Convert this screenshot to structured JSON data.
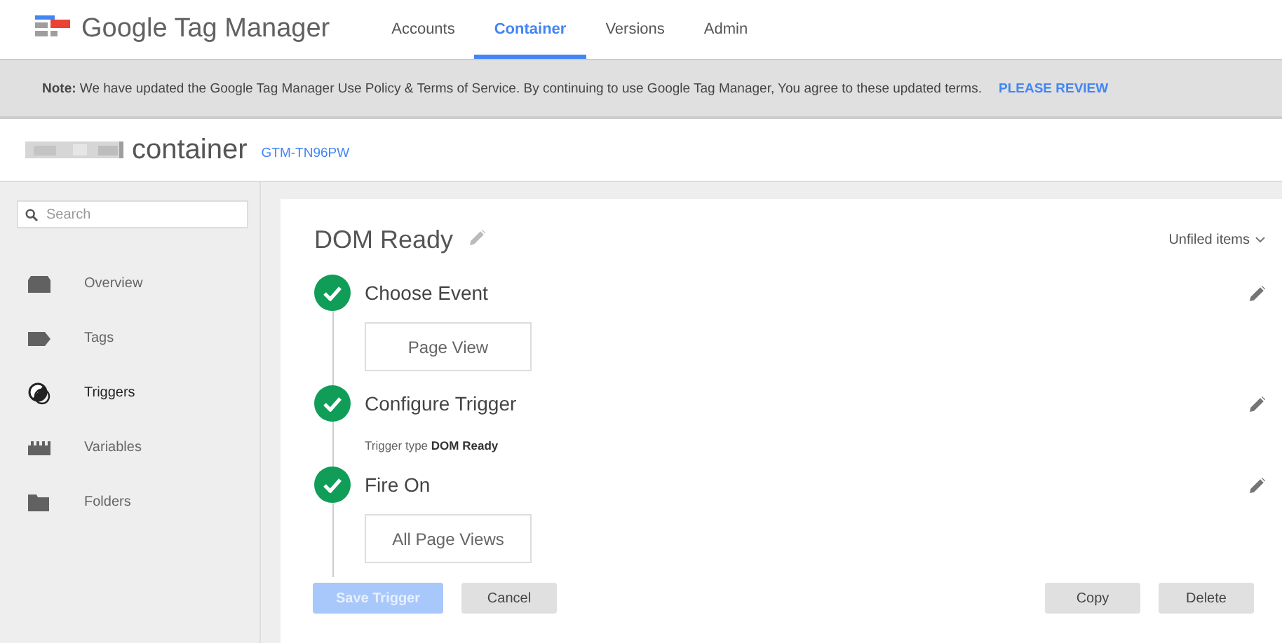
{
  "header": {
    "product": "Google Tag Manager",
    "nav": [
      {
        "label": "Accounts",
        "selected": false
      },
      {
        "label": "Container",
        "selected": true
      },
      {
        "label": "Versions",
        "selected": false
      },
      {
        "label": "Admin",
        "selected": false
      }
    ]
  },
  "notice": {
    "text": "**Note:** We have updated the Google Tag Manager Use Policy & Terms of Service. By continuing to use Google Tag Manager, You agree to these updated terms.",
    "link": "PLEASE REVIEW"
  },
  "container": {
    "title": "container",
    "id": "GTM-TN96PW"
  },
  "sidebar": {
    "search": {
      "placeholder": "Search"
    },
    "items": [
      {
        "label": "Overview",
        "selected": false
      },
      {
        "label": "Tags",
        "selected": false
      },
      {
        "label": "Triggers",
        "selected": true
      },
      {
        "label": "Variables",
        "selected": false
      },
      {
        "label": "Folders",
        "selected": false
      }
    ]
  },
  "editor": {
    "title": "DOM Ready",
    "folder": "Unfiled items",
    "steps": [
      {
        "title": "Choose Event",
        "done": true,
        "kind": "option",
        "content": "Page View"
      },
      {
        "title": "Configure Trigger",
        "done": true,
        "kind": "detail",
        "content": "Trigger type **DOM Ready**"
      },
      {
        "title": "Fire On",
        "done": true,
        "kind": "option",
        "content": "All Page Views"
      }
    ],
    "buttons": [
      {
        "label": "Save Trigger",
        "kind": "primary",
        "disabled": true
      },
      {
        "label": "Cancel",
        "kind": "secondary",
        "disabled": false
      },
      {
        "label": "Copy",
        "kind": "secondary",
        "disabled": false
      },
      {
        "label": "Delete",
        "kind": "secondary",
        "disabled": false
      }
    ]
  }
}
